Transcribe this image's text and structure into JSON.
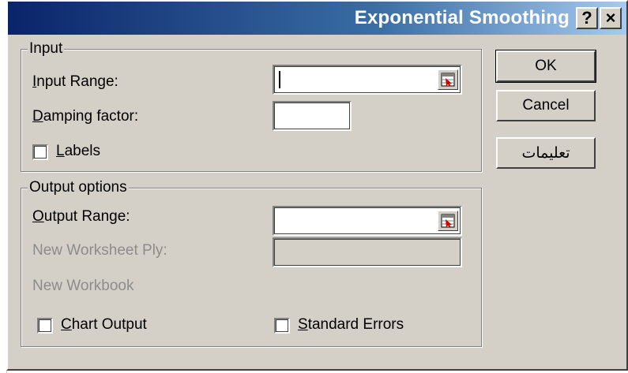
{
  "window": {
    "title": "Exponential Smoothing",
    "help_button": "?",
    "close_button": "×"
  },
  "input_group": {
    "legend": "Input",
    "input_range_label": {
      "accel": "I",
      "rest": "nput Range:"
    },
    "input_range_value": "",
    "damping_label": {
      "accel": "D",
      "rest": "amping factor:"
    },
    "damping_value": "",
    "labels_checkbox": {
      "accel": "L",
      "rest": "abels",
      "checked": false
    }
  },
  "output_group": {
    "legend": "Output options",
    "output_range_label": {
      "accel": "O",
      "rest": "utput Range:"
    },
    "output_range_value": "",
    "new_worksheet_label": "New Worksheet Ply:",
    "new_workbook_label": "New Workbook",
    "chart_output_checkbox": {
      "accel": "C",
      "rest": "hart Output",
      "checked": false
    },
    "standard_errors_checkbox": {
      "accel": "S",
      "rest": "tandard Errors",
      "checked": false
    }
  },
  "buttons": {
    "ok": "OK",
    "cancel": "Cancel",
    "help": "تعليمات"
  },
  "icons": {
    "range_selector": "range-select-icon"
  }
}
